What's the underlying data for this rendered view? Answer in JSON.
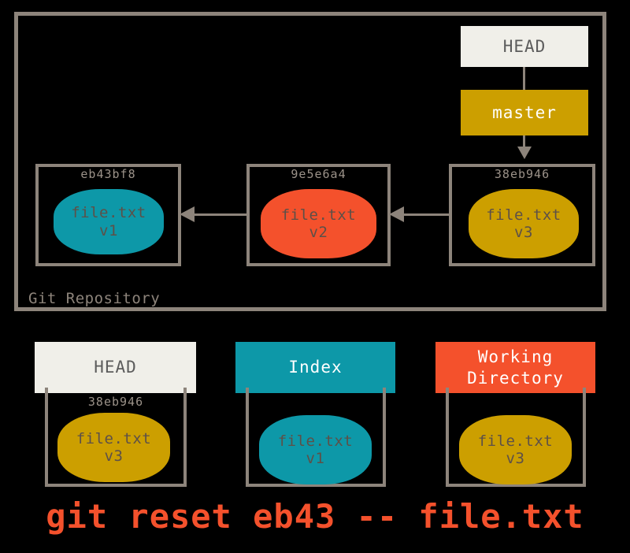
{
  "repository": {
    "label": "Git Repository",
    "border_color": "#8d847b",
    "pointers": {
      "head": {
        "label": "HEAD",
        "bg": "#f0efe9",
        "fg": "#5c5c5c"
      },
      "branch": {
        "label": "master",
        "bg": "#cc9f00",
        "fg": "#ffffff"
      }
    },
    "commits": [
      {
        "hash": "eb43bf8",
        "file_name": "file.txt",
        "version": "v1",
        "blob_color": "#0d98a8"
      },
      {
        "hash": "9e5e6a4",
        "file_name": "file.txt",
        "version": "v2",
        "blob_color": "#f4512c"
      },
      {
        "hash": "38eb946",
        "file_name": "file.txt",
        "version": "v3",
        "blob_color": "#cc9f00"
      }
    ]
  },
  "states": [
    {
      "title": "HEAD",
      "header_bg": "#f0efe9",
      "header_fg": "#5c5c5c",
      "hash": "38eb946",
      "file_name": "file.txt",
      "version": "v3",
      "blob_color": "#cc9f00"
    },
    {
      "title": "Index",
      "header_bg": "#0d98a8",
      "header_fg": "#ffffff",
      "hash": "",
      "file_name": "file.txt",
      "version": "v1",
      "blob_color": "#0d98a8"
    },
    {
      "title": "Working\nDirectory",
      "title_line1": "Working",
      "title_line2": "Directory",
      "header_bg": "#f4512c",
      "header_fg": "#ffffff",
      "hash": "",
      "file_name": "file.txt",
      "version": "v3",
      "blob_color": "#cc9f00"
    }
  ],
  "command": {
    "text": "git reset eb43 -- file.txt",
    "color": "#f4512c"
  },
  "palette": {
    "background": "#000000",
    "teal": "#0d98a8",
    "orange": "#f4512c",
    "gold": "#cc9f00",
    "cream": "#f0efe9",
    "gray_line": "#8d847b",
    "hash_text": "#9b9289",
    "blob_text": "#5d5048"
  }
}
